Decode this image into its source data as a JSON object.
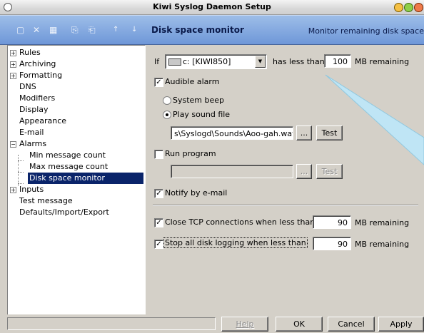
{
  "window": {
    "title": "Kiwi Syslog Daemon Setup"
  },
  "toolbar": {
    "section_title": "Disk space monitor",
    "section_description": "Monitor remaining disk space"
  },
  "tree": {
    "items": [
      {
        "label": "Rules",
        "expander": "+"
      },
      {
        "label": "Archiving",
        "expander": "+"
      },
      {
        "label": "Formatting",
        "expander": "+"
      },
      {
        "label": "DNS"
      },
      {
        "label": "Modifiers"
      },
      {
        "label": "Display"
      },
      {
        "label": "Appearance"
      },
      {
        "label": "E-mail"
      },
      {
        "label": "Alarms",
        "expander": "−"
      },
      {
        "label": "Min message count"
      },
      {
        "label": "Max message count"
      },
      {
        "label": "Disk space monitor"
      },
      {
        "label": "Inputs",
        "expander": "+"
      },
      {
        "label": "Test message"
      },
      {
        "label": "Defaults/Import/Export"
      }
    ]
  },
  "form": {
    "if_label": "If",
    "drive_value": "c: [KIWI850]",
    "has_less_than": "has less than",
    "mb_value": "100",
    "mb_remaining": "MB remaining",
    "audible_alarm": {
      "label": "Audible alarm",
      "checked": "✓"
    },
    "system_beep": "System beep",
    "play_sound": "Play sound file",
    "sound_path": "s\\Syslogd\\Sounds\\Aoo-gah.wav",
    "browse": "...",
    "test": "Test",
    "run_program": {
      "label": "Run program",
      "checked": ""
    },
    "run_program_path": "",
    "notify_email": {
      "label": "Notify by e-mail",
      "checked": "✓"
    },
    "close_tcp": {
      "label": "Close TCP connections when less than",
      "checked": "✓",
      "value": "90",
      "suffix": "MB remaining"
    },
    "stop_logging": {
      "label": "Stop all disk logging when less than",
      "checked": "✓",
      "value": "90",
      "suffix": "MB remaining"
    }
  },
  "buttons": {
    "help": "Help",
    "ok": "OK",
    "cancel": "Cancel",
    "apply": "Apply"
  }
}
